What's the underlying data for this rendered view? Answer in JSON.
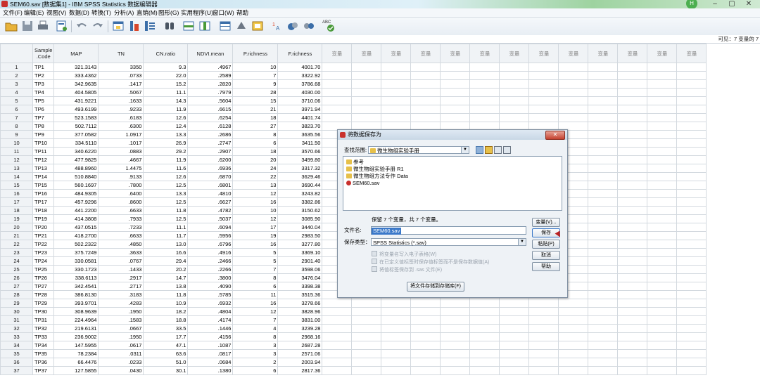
{
  "window": {
    "title": "SEM60.sav [数据集1] - IBM SPSS Statistics 数据编辑器",
    "user_badge": "H",
    "controls": [
      "–",
      "▢",
      "✕"
    ]
  },
  "menu": [
    "文件(F)",
    "编辑(E)",
    "视图(V)",
    "数据(D)",
    "转换(T)",
    "分析(A)",
    "直销(M)",
    "图形(G)",
    "实用程序(U)",
    "窗口(W)",
    "帮助"
  ],
  "toolbar": {
    "icons": [
      "open-icon",
      "save-icon",
      "print-icon",
      "dialog-recall-icon",
      "undo-icon",
      "redo-icon",
      "goto-case-icon",
      "goto-variable-icon",
      "variables-icon",
      "find-icon",
      "insert-cases-icon",
      "insert-variable-icon",
      "split-file-icon",
      "weight-cases-icon",
      "select-cases-icon",
      "value-labels-icon",
      "use-sets-icon",
      "show-sets-icon",
      "spelling-icon"
    ],
    "spelling_text": "ABC"
  },
  "cellbar": {
    "visible_info": "可见：7 变量的 7"
  },
  "grid": {
    "columns": [
      "Sample_Code",
      "MAP",
      "TN",
      "CN.ratio",
      "NDVI.mean",
      "P.richness",
      "F.richness"
    ],
    "column_headers": [
      [
        "Sample",
        ".Code"
      ],
      [
        "MAP"
      ],
      [
        "TN"
      ],
      [
        "CN.ratio"
      ],
      [
        "NDVI.mean"
      ],
      [
        "P.richness"
      ],
      [
        "F.richness"
      ]
    ],
    "empty_header": "变量",
    "empty_column_count": 13,
    "rows": [
      [
        "1",
        "TP1",
        "321.3143",
        "3350",
        "9.3",
        ".4967",
        "10",
        "4001.70"
      ],
      [
        "2",
        "TP2",
        "333.4362",
        ".0733",
        "22.0",
        ".2589",
        "7",
        "3322.92"
      ],
      [
        "3",
        "TP3",
        "342.9635",
        ".1417",
        "15.2",
        ".2820",
        "9",
        "3786.68"
      ],
      [
        "4",
        "TP4",
        "404.5805",
        ".5067",
        "11.1",
        ".7979",
        "28",
        "4030.00"
      ],
      [
        "5",
        "TP5",
        "431.9221",
        ".1633",
        "14.3",
        ".5604",
        "15",
        "3710.06"
      ],
      [
        "6",
        "TP6",
        "493.6199",
        ".9233",
        "11.9",
        ".6615",
        "21",
        "3971.94"
      ],
      [
        "7",
        "TP7",
        "523.1583",
        ".6183",
        "12.6",
        ".6254",
        "18",
        "4401.74"
      ],
      [
        "8",
        "TP8",
        "502.7112",
        ".6300",
        "12.4",
        ".6128",
        "27",
        "3823.70"
      ],
      [
        "9",
        "TP9",
        "377.0582",
        "1.0917",
        "13.3",
        ".2686",
        "8",
        "3635.56"
      ],
      [
        "10",
        "TP10",
        "334.5110",
        ".1017",
        "26.9",
        ".2747",
        "6",
        "3411.50"
      ],
      [
        "11",
        "TP11",
        "340.6220",
        ".0883",
        "29.2",
        ".2907",
        "18",
        "3570.66"
      ],
      [
        "12",
        "TP12",
        "477.9825",
        ".4667",
        "11.9",
        ".6200",
        "20",
        "3499.80"
      ],
      [
        "13",
        "TP13",
        "488.8960",
        "1.4475",
        "11.6",
        ".6936",
        "24",
        "3317.32"
      ],
      [
        "14",
        "TP14",
        "510.8840",
        ".9133",
        "12.6",
        ".6870",
        "22",
        "3629.46"
      ],
      [
        "15",
        "TP15",
        "560.1697",
        ".7800",
        "12.5",
        ".6801",
        "13",
        "3690.44"
      ],
      [
        "16",
        "TP16",
        "484.9305",
        ".6400",
        "13.3",
        ".4810",
        "12",
        "3243.82"
      ],
      [
        "17",
        "TP17",
        "457.9296",
        ".8600",
        "12.5",
        ".6627",
        "16",
        "3382.86"
      ],
      [
        "18",
        "TP18",
        "441.2200",
        ".6633",
        "11.8",
        ".4782",
        "10",
        "3150.62"
      ],
      [
        "19",
        "TP19",
        "414.3808",
        ".7933",
        "12.5",
        ".5037",
        "12",
        "3085.90"
      ],
      [
        "20",
        "TP20",
        "437.0515",
        ".7233",
        "11.1",
        ".6094",
        "17",
        "3440.04"
      ],
      [
        "21",
        "TP21",
        "418.2700",
        ".6633",
        "11.7",
        ".5956",
        "19",
        "2983.50"
      ],
      [
        "22",
        "TP22",
        "502.2322",
        ".4850",
        "13.0",
        ".6796",
        "16",
        "3277.80"
      ],
      [
        "23",
        "TP23",
        "375.7249",
        ".3633",
        "16.6",
        ".4916",
        "5",
        "3369.10"
      ],
      [
        "24",
        "TP24",
        "330.0581",
        ".0767",
        "29.4",
        ".2466",
        "5",
        "2901.40"
      ],
      [
        "25",
        "TP25",
        "330.1723",
        ".1433",
        "20.2",
        ".2266",
        "7",
        "3598.06"
      ],
      [
        "26",
        "TP26",
        "338.6113",
        ".2917",
        "14.7",
        ".3800",
        "8",
        "3476.04"
      ],
      [
        "27",
        "TP27",
        "342.4541",
        ".2717",
        "13.8",
        ".4090",
        "6",
        "3398.38"
      ],
      [
        "28",
        "TP28",
        "386.8130",
        ".3183",
        "11.8",
        ".5785",
        "11",
        "3515.36"
      ],
      [
        "29",
        "TP29",
        "393.9701",
        ".4283",
        "10.9",
        ".6932",
        "16",
        "3278.66"
      ],
      [
        "30",
        "TP30",
        "308.9639",
        ".1950",
        "18.2",
        ".4804",
        "12",
        "3828.96"
      ],
      [
        "31",
        "TP31",
        "224.4964",
        ".1583",
        "18.8",
        ".4174",
        "7",
        "3831.00"
      ],
      [
        "32",
        "TP32",
        "219.6131",
        ".0667",
        "33.5",
        ".1446",
        "4",
        "3239.28"
      ],
      [
        "33",
        "TP33",
        "236.9002",
        ".1950",
        "17.7",
        ".4156",
        "8",
        "2968.16"
      ],
      [
        "34",
        "TP34",
        "147.5955",
        ".0617",
        "47.1",
        ".1087",
        "3",
        "2687.28"
      ],
      [
        "35",
        "TP35",
        "78.2384",
        ".0311",
        "63.6",
        ".0817",
        "3",
        "2571.06"
      ],
      [
        "36",
        "TP36",
        "66.4476",
        ".0233",
        "51.0",
        ".0684",
        "2",
        "2003.94"
      ],
      [
        "37",
        "TP37",
        "127.5855",
        ".0430",
        "30.1",
        ".1380",
        "6",
        "2817.36"
      ]
    ]
  },
  "dialog": {
    "title": "将数据保存为",
    "look_in_label": "查找范围:",
    "look_in_value": "微生物组实验手册",
    "files": [
      {
        "name": "参考",
        "type": "folder"
      },
      {
        "name": "微生物组实验手册 R1",
        "type": "folder"
      },
      {
        "name": "微生物组方法专作 Data",
        "type": "folder"
      },
      {
        "name": "SEM60.sav",
        "type": "sav"
      }
    ],
    "keep_info": "保留 7 个变量，共 7 个变量。",
    "filename_label": "文件名:",
    "filename_value": "SEM60.sav",
    "save_type_label": "保存类型：",
    "save_type_value": "SPSS Statistics (*.sav)",
    "options": [
      "将变量名写入电子表格(W)",
      "在已定义值标签时保存值标签而不是保存数据值(A)",
      "将值标签保存到 .sas 文件(E)"
    ],
    "store_button": "将文件存储到存储库(F)",
    "buttons": [
      "变量(V)...",
      "保存",
      "粘贴(P)",
      "取消",
      "帮助"
    ]
  }
}
